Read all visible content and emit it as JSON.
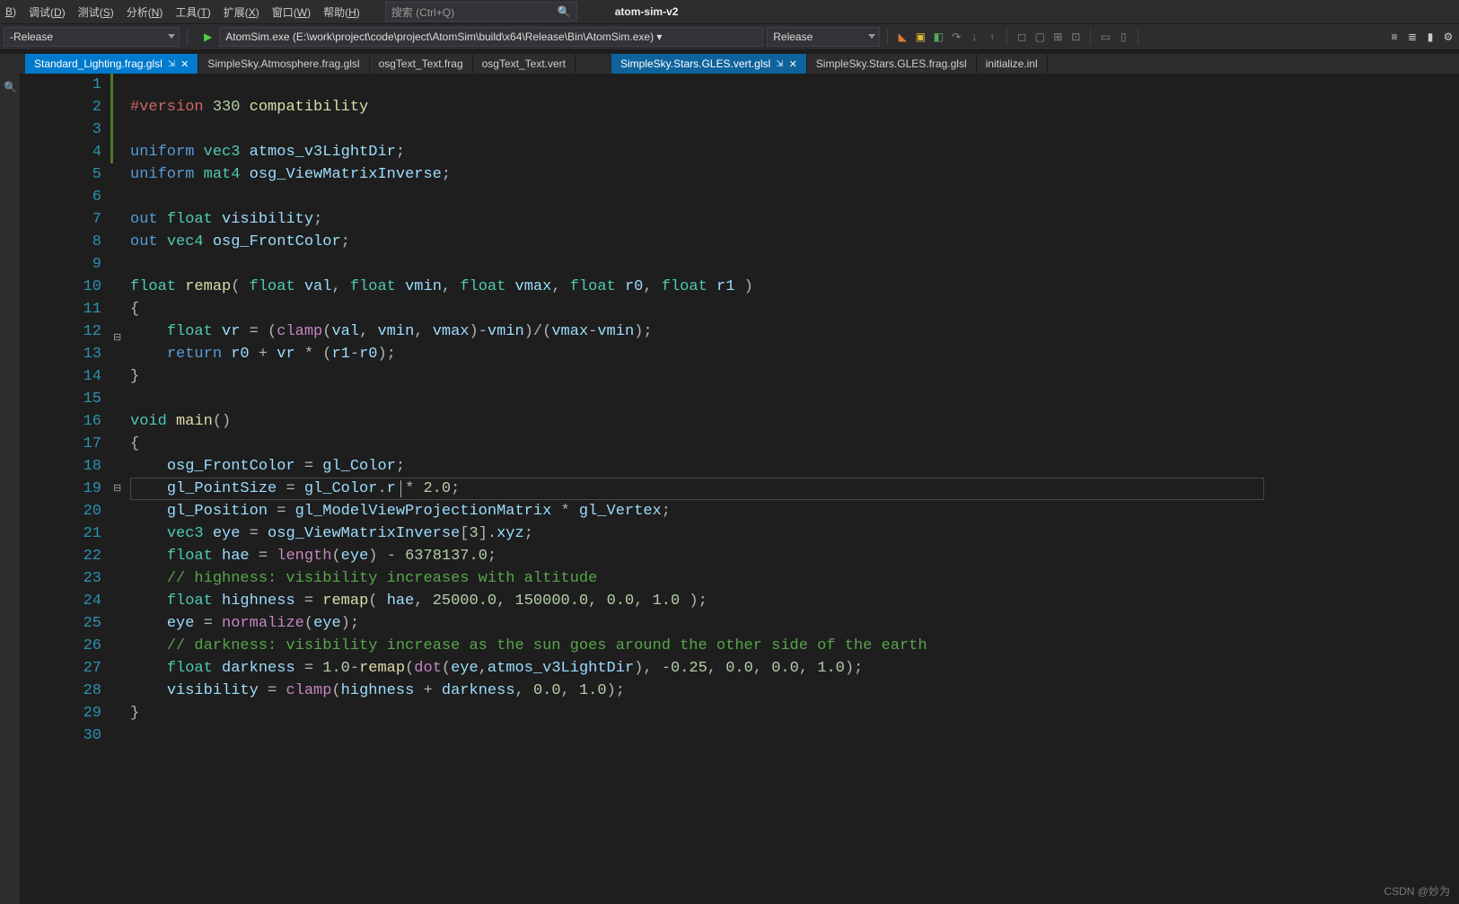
{
  "menubar": {
    "items": [
      {
        "pre": "",
        "u": "B",
        "post": ")"
      },
      {
        "pre": "调试(",
        "u": "D",
        "post": ")"
      },
      {
        "pre": "测试(",
        "u": "S",
        "post": ")"
      },
      {
        "pre": "分析(",
        "u": "N",
        "post": ")"
      },
      {
        "pre": "工具(",
        "u": "T",
        "post": ")"
      },
      {
        "pre": "扩展(",
        "u": "X",
        "post": ")"
      },
      {
        "pre": "窗口(",
        "u": "W",
        "post": ")"
      },
      {
        "pre": "帮助(",
        "u": "H",
        "post": ")"
      }
    ],
    "search_placeholder": "搜索 (Ctrl+Q)",
    "title": "atom-sim-v2"
  },
  "toolbar": {
    "config": "-Release",
    "target": "AtomSim.exe (E:\\work\\project\\code\\project\\AtomSim\\build\\x64\\Release\\Bin\\AtomSim.exe) ▾",
    "buildcfg": "Release"
  },
  "tabs": {
    "left": [
      {
        "label": "Standard_Lighting.frag.glsl",
        "active": true,
        "pinned": true,
        "close": true
      },
      {
        "label": "SimpleSky.Atmosphere.frag.glsl",
        "active": false
      },
      {
        "label": "osgText_Text.frag",
        "active": false
      },
      {
        "label": "osgText_Text.vert",
        "active": false
      }
    ],
    "right": [
      {
        "label": "SimpleSky.Stars.GLES.vert.glsl",
        "active": true,
        "pinned": true,
        "close": true
      },
      {
        "label": "SimpleSky.Stars.GLES.frag.glsl",
        "active": false
      },
      {
        "label": "initialize.inl",
        "active": false
      }
    ]
  },
  "code": {
    "lines": [
      {
        "n": 1,
        "mod": true,
        "html": ""
      },
      {
        "n": 2,
        "mod": true,
        "html": "<span class='dir'>#version</span> <span class='num'>330</span> <span class='id'>compatibility</span>"
      },
      {
        "n": 3,
        "mod": true,
        "html": ""
      },
      {
        "n": 4,
        "mod": true,
        "html": "<span class='kw'>uniform</span> <span class='typ'>vec3</span> <span class='var'>atmos_v3LightDir</span><span class='op'>;</span>"
      },
      {
        "n": 5,
        "html": "<span class='kw'>uniform</span> <span class='typ'>mat4</span> <span class='var'>osg_ViewMatrixInverse</span><span class='op'>;</span>"
      },
      {
        "n": 6,
        "html": ""
      },
      {
        "n": 7,
        "html": "<span class='kw'>out</span> <span class='typ'>float</span> <span class='var'>visibility</span><span class='op'>;</span>"
      },
      {
        "n": 8,
        "html": "<span class='kw'>out</span> <span class='typ'>vec4</span> <span class='var'>osg_FrontColor</span><span class='op'>;</span>"
      },
      {
        "n": 9,
        "html": ""
      },
      {
        "n": 10,
        "html": "<span class='typ'>float</span> <span class='id'>remap</span><span class='op'>(</span> <span class='typ'>float</span> <span class='var'>val</span><span class='op'>,</span> <span class='typ'>float</span> <span class='var'>vmin</span><span class='op'>,</span> <span class='typ'>float</span> <span class='var'>vmax</span><span class='op'>,</span> <span class='typ'>float</span> <span class='var'>r0</span><span class='op'>,</span> <span class='typ'>float</span> <span class='var'>r1</span> <span class='op'>)</span>"
      },
      {
        "n": 11,
        "fold": "⊟",
        "html": "<span class='op'>{</span>"
      },
      {
        "n": 12,
        "html": "    <span class='typ'>float</span> <span class='var'>vr</span> <span class='op'>=</span> <span class='op'>(</span><span class='fn'>clamp</span><span class='op'>(</span><span class='var'>val</span><span class='op'>,</span> <span class='var'>vmin</span><span class='op'>,</span> <span class='var'>vmax</span><span class='op'>)-</span><span class='var'>vmin</span><span class='op'>)/(</span><span class='var'>vmax</span><span class='op'>-</span><span class='var'>vmin</span><span class='op'>);</span>"
      },
      {
        "n": 13,
        "html": "    <span class='kw'>return</span> <span class='var'>r0</span> <span class='op'>+</span> <span class='var'>vr</span> <span class='op'>*</span> <span class='op'>(</span><span class='var'>r1</span><span class='op'>-</span><span class='var'>r0</span><span class='op'>);</span>"
      },
      {
        "n": 14,
        "html": "<span class='op'>}</span>"
      },
      {
        "n": 15,
        "html": ""
      },
      {
        "n": 16,
        "html": "<span class='typ'>void</span> <span class='id'>main</span><span class='op'>()</span>"
      },
      {
        "n": 17,
        "fold": "⊟",
        "html": "<span class='op'>{</span>"
      },
      {
        "n": 18,
        "html": "    <span class='var'>osg_FrontColor</span> <span class='op'>=</span> <span class='var'>gl_Color</span><span class='op'>;</span>"
      },
      {
        "n": 19,
        "hl": true,
        "html": "    <span class='var'>gl_PointSize</span> <span class='op'>=</span> <span class='var'>gl_Color</span><span class='op'>.</span><span class='var'>r</span> <span class='op'>*</span> <span class='num'>2.0</span><span class='op'>;</span>"
      },
      {
        "n": 20,
        "html": "    <span class='var'>gl_Position</span> <span class='op'>=</span> <span class='var'>gl_ModelViewProjectionMatrix</span> <span class='op'>*</span> <span class='var'>gl_Vertex</span><span class='op'>;</span>"
      },
      {
        "n": 21,
        "html": "    <span class='typ'>vec3</span> <span class='var'>eye</span> <span class='op'>=</span> <span class='var'>osg_ViewMatrixInverse</span><span class='op'>[</span><span class='num'>3</span><span class='op'>].</span><span class='var'>xyz</span><span class='op'>;</span>"
      },
      {
        "n": 22,
        "html": "    <span class='typ'>float</span> <span class='var'>hae</span> <span class='op'>=</span> <span class='fn'>length</span><span class='op'>(</span><span class='var'>eye</span><span class='op'>)</span> <span class='op'>-</span> <span class='num'>6378137.0</span><span class='op'>;</span>"
      },
      {
        "n": 23,
        "html": "    <span class='cmt'>// highness: visibility increases with altitude</span>"
      },
      {
        "n": 24,
        "html": "    <span class='typ'>float</span> <span class='var'>highness</span> <span class='op'>=</span> <span class='id'>remap</span><span class='op'>(</span> <span class='var'>hae</span><span class='op'>,</span> <span class='num'>25000.0</span><span class='op'>,</span> <span class='num'>150000.0</span><span class='op'>,</span> <span class='num'>0.0</span><span class='op'>,</span> <span class='num'>1.0</span> <span class='op'>);</span>"
      },
      {
        "n": 25,
        "html": "    <span class='var'>eye</span> <span class='op'>=</span> <span class='fn'>normalize</span><span class='op'>(</span><span class='var'>eye</span><span class='op'>);</span>"
      },
      {
        "n": 26,
        "html": "    <span class='cmt'>// darkness: visibility increase as the sun goes around the other side of the earth</span>"
      },
      {
        "n": 27,
        "html": "    <span class='typ'>float</span> <span class='var'>darkness</span> <span class='op'>=</span> <span class='num'>1.0</span><span class='op'>-</span><span class='id'>remap</span><span class='op'>(</span><span class='fn'>dot</span><span class='op'>(</span><span class='var'>eye</span><span class='op'>,</span><span class='var'>atmos_v3LightDir</span><span class='op'>),</span> <span class='op'>-</span><span class='num'>0.25</span><span class='op'>,</span> <span class='num'>0.0</span><span class='op'>,</span> <span class='num'>0.0</span><span class='op'>,</span> <span class='num'>1.0</span><span class='op'>);</span>"
      },
      {
        "n": 28,
        "html": "    <span class='var'>visibility</span> <span class='op'>=</span> <span class='fn'>clamp</span><span class='op'>(</span><span class='var'>highness</span> <span class='op'>+</span> <span class='var'>darkness</span><span class='op'>,</span> <span class='num'>0.0</span><span class='op'>,</span> <span class='num'>1.0</span><span class='op'>);</span>"
      },
      {
        "n": 29,
        "html": "<span class='op'>}</span>"
      },
      {
        "n": 30,
        "html": ""
      }
    ]
  },
  "watermark": "CSDN @妙为"
}
